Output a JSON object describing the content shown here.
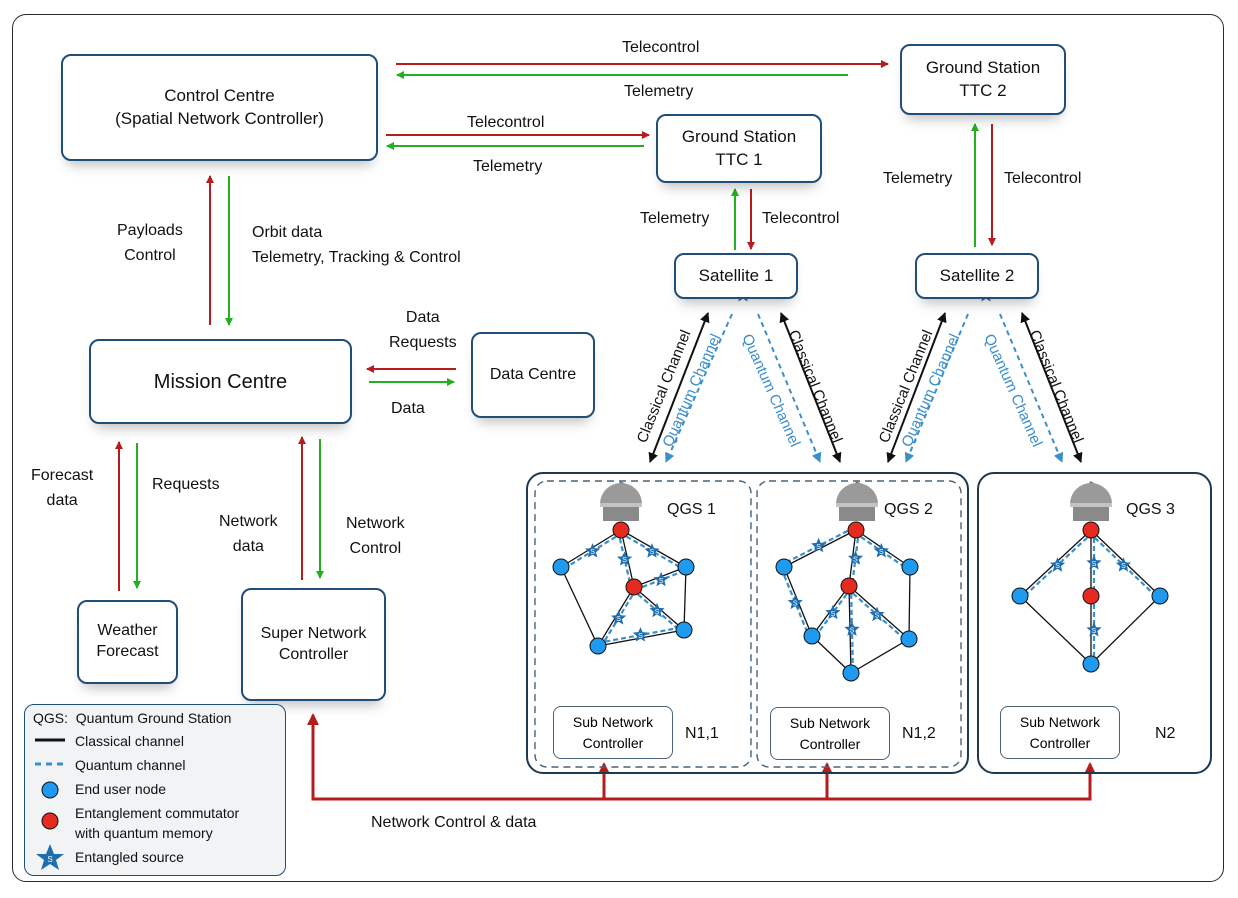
{
  "colors": {
    "box_border": "#1f4e79",
    "telecontrol": "#b71c1c",
    "telemetry": "#22b022",
    "classical": "#111111",
    "quantum": "#3b8fc9",
    "end_user_node": "#1e9af0",
    "commutator_node": "#e52b20"
  },
  "boxes": {
    "control_centre": "Control Centre\n(Spatial Network Controller)",
    "ground_station_1": "Ground Station\nTTC 1",
    "ground_station_2": "Ground Station\nTTC 2",
    "satellite_1": "Satellite 1",
    "satellite_2": "Satellite 2",
    "mission_centre": "Mission Centre",
    "data_centre": "Data Centre",
    "weather_forecast": "Weather\nForecast",
    "super_network_controller": "Super Network\nController"
  },
  "links": {
    "cc_gs2_telecontrol": "Telecontrol",
    "cc_gs2_telemetry": "Telemetry",
    "cc_gs1_telecontrol": "Telecontrol",
    "cc_gs1_telemetry": "Telemetry",
    "gs1_sat1_telemetry": "Telemetry",
    "gs1_sat1_telecontrol": "Telecontrol",
    "gs2_sat2_telemetry": "Telemetry",
    "gs2_sat2_telecontrol": "Telecontrol",
    "mc_cc_up": "Payloads\nControl",
    "mc_cc_down": "Orbit data\nTelemetry, Tracking & Control",
    "dc_mc_requests": "Data\nRequests",
    "dc_mc_data": "Data",
    "wf_forecast": "Forecast\ndata",
    "wf_requests": "Requests",
    "snc_network_data": "Network\ndata",
    "snc_network_control": "Network\nControl",
    "bus": "Network Control & data"
  },
  "channels": {
    "classical": "Classical Channel",
    "quantum": "Quantum Channel"
  },
  "stations": [
    {
      "name": "QGS 1",
      "subnet": "N1,1",
      "controller": "Sub Network\nController"
    },
    {
      "name": "QGS 2",
      "subnet": "N1,2",
      "controller": "Sub Network\nController"
    },
    {
      "name": "QGS 3",
      "subnet": "N2",
      "controller": "Sub Network\nController"
    }
  ],
  "source_glyph": "S",
  "legend": {
    "qgs": "QGS:  Quantum Ground Station",
    "classical": "Classical channel",
    "quantum": "Quantum channel",
    "end_user": "End user node",
    "commutator": "Entanglement commutator\nwith quantum memory",
    "source": "Entangled source"
  }
}
